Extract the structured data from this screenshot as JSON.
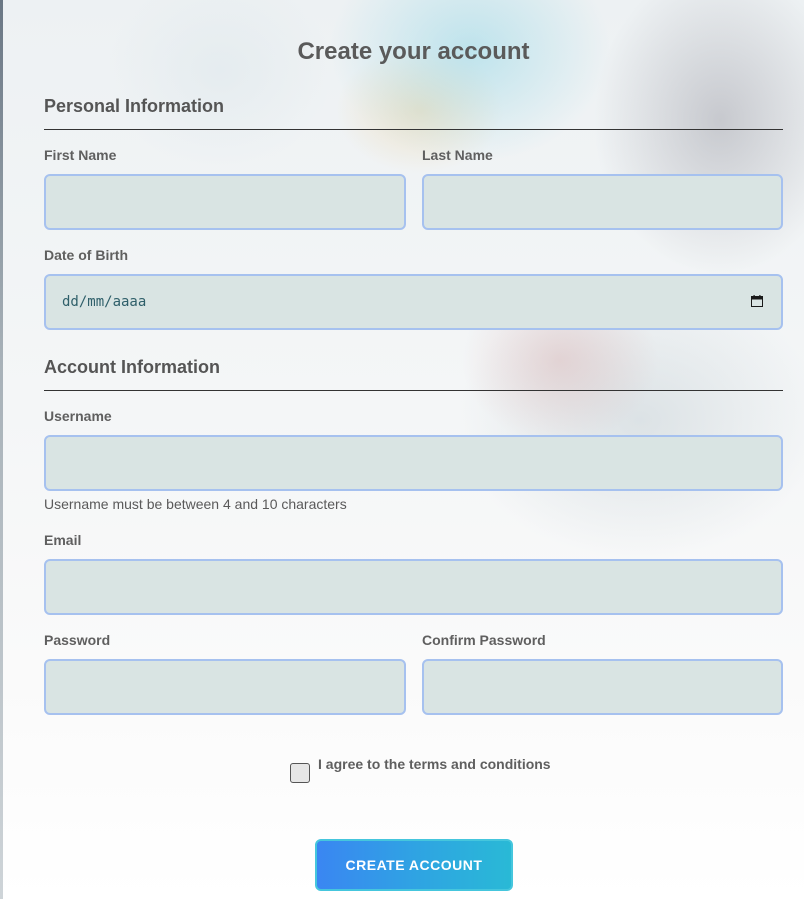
{
  "form": {
    "title": "Create your account",
    "personal_section": "Personal Information",
    "first_name_label": "First Name",
    "last_name_label": "Last Name",
    "first_name_value": "",
    "last_name_value": "",
    "dob_label": "Date of Birth",
    "dob_placeholder": "dd/mm/aaaa",
    "account_section": "Account Information",
    "username_label": "Username",
    "username_value": "",
    "username_help": "Username must be between 4 and 10 characters",
    "email_label": "Email",
    "email_value": "",
    "password_label": "Password",
    "password_value": "",
    "confirm_password_label": "Confirm Password",
    "confirm_password_value": "",
    "terms_label": "I agree to the terms and conditions",
    "terms_checked": false,
    "submit_label": "CREATE ACCOUNT"
  },
  "icons": {
    "date": "calendar-icon"
  },
  "colors": {
    "input_bg": "#d9e4e3",
    "input_border": "#a6c1ef",
    "button_start": "#3a86f2",
    "button_end": "#29b9d6"
  }
}
